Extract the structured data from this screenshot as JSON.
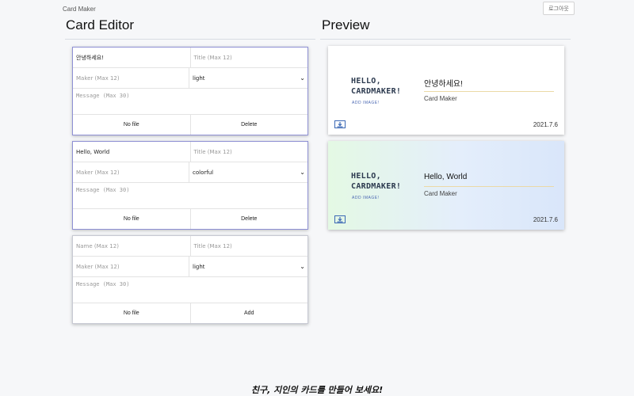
{
  "header": {
    "app_title": "Card Maker",
    "logout_label": "로그아웃"
  },
  "editor": {
    "title": "Card Editor",
    "cards": [
      {
        "name_value": "안녕하세요!",
        "title_placeholder": "Title (Max 12)",
        "maker_placeholder": "Maker (Max 12)",
        "theme": "light",
        "message_placeholder": "Message (Max 30)",
        "file_label": "No file",
        "action_label": "Delete"
      },
      {
        "name_value": "Hello, World",
        "title_placeholder": "Title (Max 12)",
        "maker_placeholder": "Maker (Max 12)",
        "theme": "colorful",
        "message_placeholder": "Message (Max 30)",
        "file_label": "No file",
        "action_label": "Delete"
      }
    ],
    "add_form": {
      "name_placeholder": "Name (Max 12)",
      "title_placeholder": "Title (Max 12)",
      "maker_placeholder": "Maker (Max 12)",
      "theme": "light",
      "message_placeholder": "Message (Max 30)",
      "file_label": "No file",
      "action_label": "Add"
    }
  },
  "preview": {
    "title": "Preview",
    "cards": [
      {
        "logo_line1": "HELLO,",
        "logo_line2": "CARDMAKER!",
        "add_image": "ADD IMAGE!",
        "name": "안녕하세요!",
        "company": "Card Maker",
        "date": "2021.7.6",
        "theme": "light"
      },
      {
        "logo_line1": "HELLO,",
        "logo_line2": "CARDMAKER!",
        "add_image": "ADD IMAGE!",
        "name": "Hello, World",
        "company": "Card Maker",
        "date": "2021.7.6",
        "theme": "colorful"
      }
    ]
  },
  "footer": {
    "text": "친구, 지인의 카드를 만들어 보세요!"
  },
  "colors": {
    "editor_border_active": "#8e90d4",
    "accent_blue": "#3c69b5",
    "divider_gold": "#ebd9a6"
  }
}
